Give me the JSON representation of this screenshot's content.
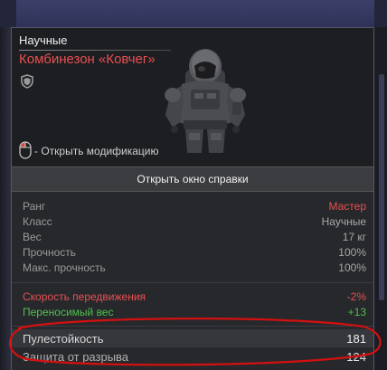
{
  "item": {
    "category": "Научные",
    "name": "Комбинезон «Ковчег»",
    "modification_hint": "- Открыть модификацию",
    "help_button_label": "Открыть окно справки"
  },
  "info_rows": [
    {
      "label": "Ранг",
      "value": "Мастер",
      "value_color": "#e85050"
    },
    {
      "label": "Класс",
      "value": "Научные"
    },
    {
      "label": "Вес",
      "value": "17 кг"
    },
    {
      "label": "Прочность",
      "value": "100%"
    },
    {
      "label": "Макс. прочность",
      "value": "100%"
    }
  ],
  "modifiers": [
    {
      "label": "Скорость передвижения",
      "value": "-2%",
      "color": "#e85050"
    },
    {
      "label": "Переносимый вес",
      "value": "+13",
      "color": "#4fc04f"
    }
  ],
  "protection": [
    {
      "label": "Пулестойкость",
      "value": "181"
    },
    {
      "label": "Защита от разрыва",
      "value": "124"
    }
  ],
  "icons": {
    "shield": "shield-icon",
    "mouse": "mouse-left-click-icon"
  },
  "annotation_color": "#d41010"
}
